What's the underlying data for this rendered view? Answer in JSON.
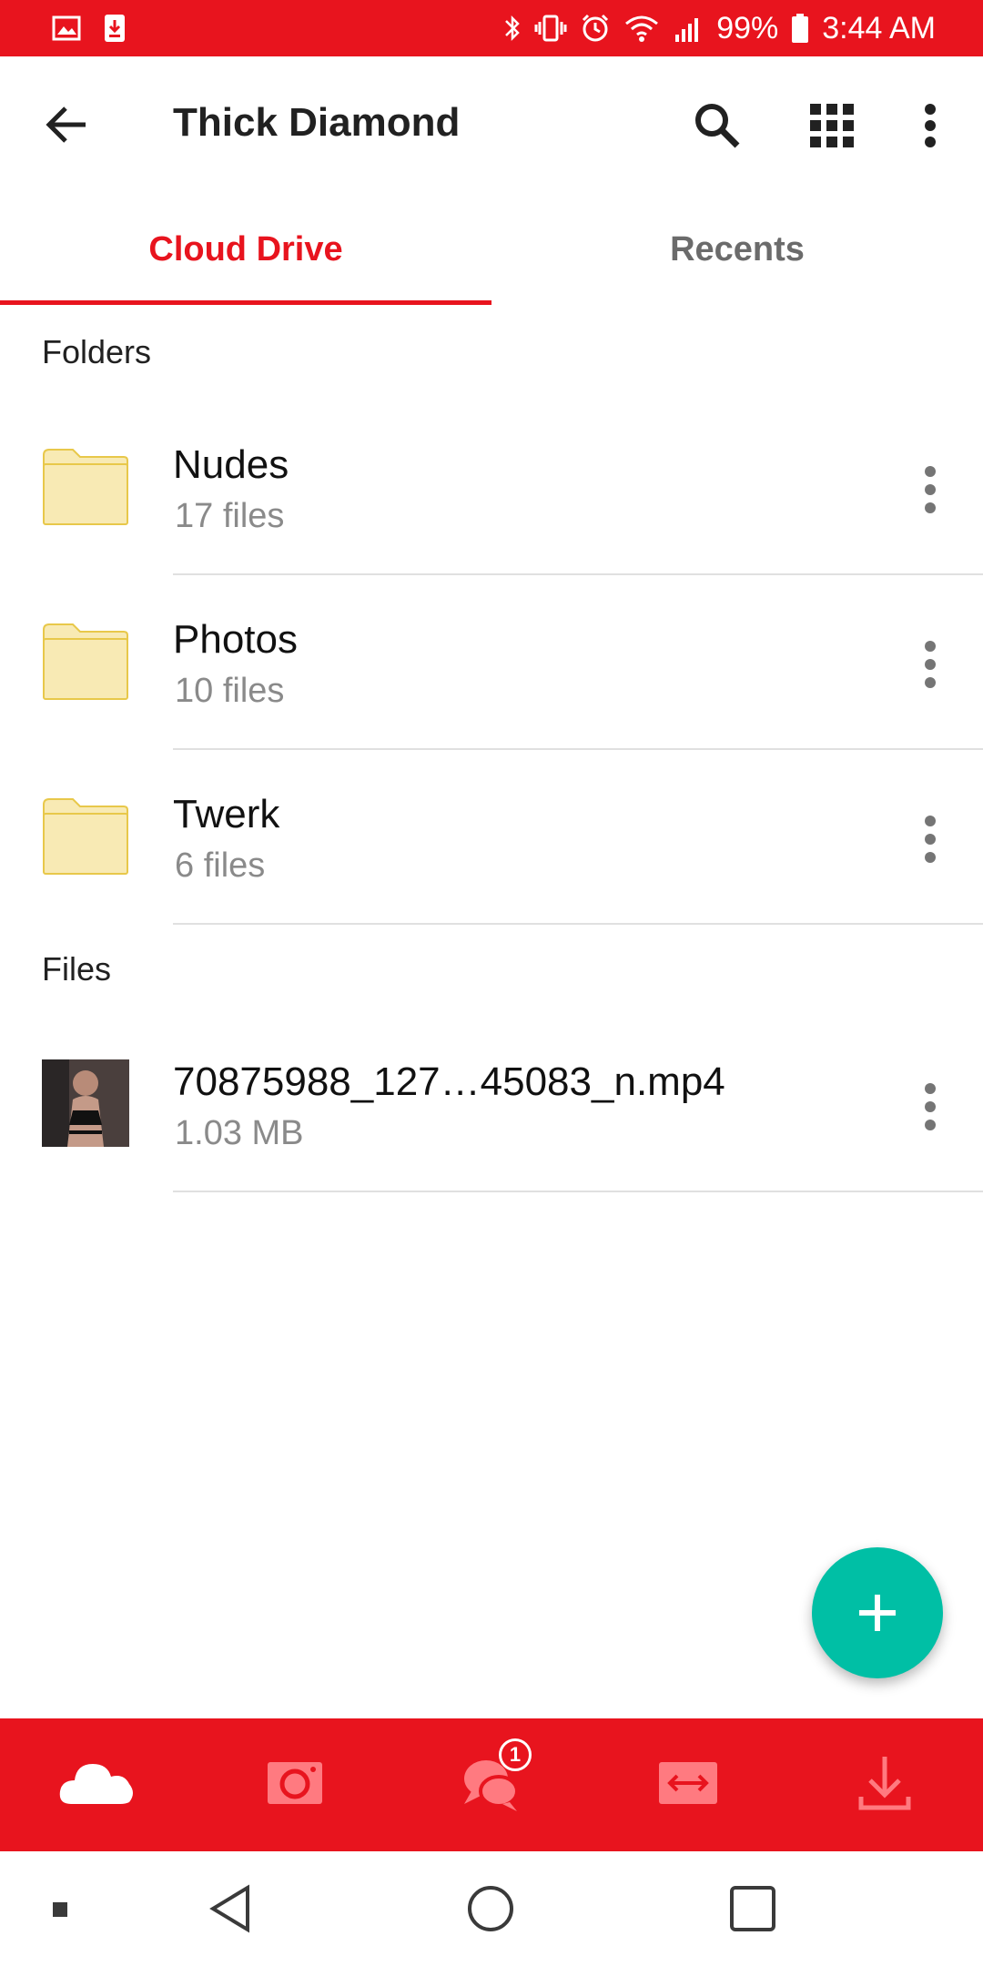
{
  "status_bar": {
    "battery": "99%",
    "time": "3:44 AM",
    "icons": [
      "gallery-icon",
      "download-notification-icon",
      "bluetooth-icon",
      "vibrate-icon",
      "alarm-icon",
      "wifi-icon",
      "signal-icon",
      "battery-icon"
    ]
  },
  "app_bar": {
    "title": "Thick Diamond",
    "icons": [
      "back-arrow-icon",
      "search-icon",
      "grid-view-icon",
      "more-vert-icon"
    ]
  },
  "tabs": [
    {
      "label": "Cloud Drive",
      "active": true
    },
    {
      "label": "Recents",
      "active": false
    }
  ],
  "sections": {
    "folders_label": "Folders",
    "files_label": "Files"
  },
  "folders": [
    {
      "name": "Nudes",
      "count": "17 files"
    },
    {
      "name": "Photos",
      "count": "10 files"
    },
    {
      "name": "Twerk",
      "count": "6 files"
    }
  ],
  "files": [
    {
      "name": "70875988_127…45083_n.mp4",
      "size": "1.03 MB"
    }
  ],
  "fab": {
    "icon": "plus-icon"
  },
  "bottom_nav": {
    "items": [
      "cloud-icon",
      "camera-icon",
      "chat-icon",
      "transfers-icon",
      "download-icon"
    ],
    "chat_badge": "1"
  },
  "colors": {
    "brand": "#e8141e",
    "fab": "#00bfa5",
    "folder": "#f8eab4"
  }
}
